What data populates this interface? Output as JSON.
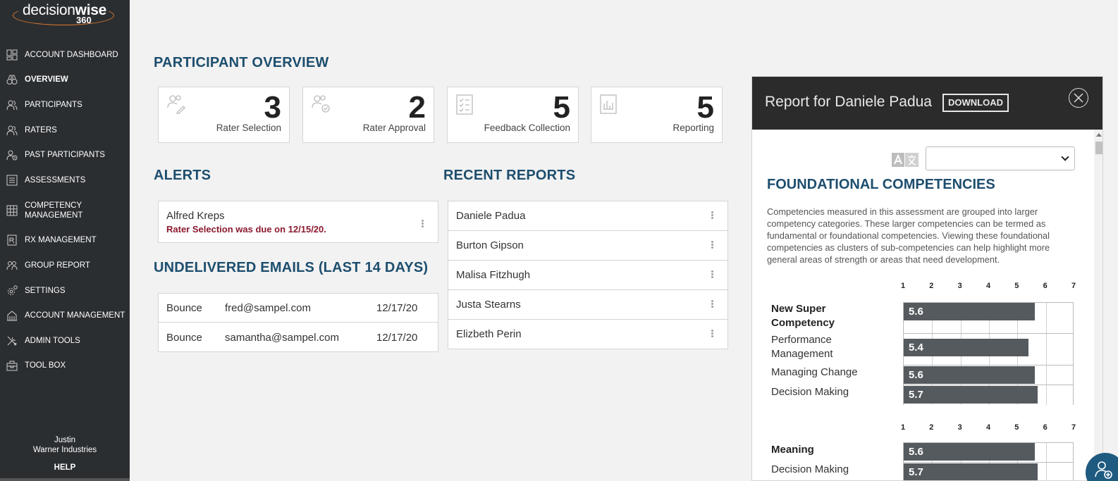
{
  "brand": {
    "word_light": "decision",
    "word_bold": "wise",
    "number": "360",
    "accent": "#e07a2f"
  },
  "sidebar": {
    "items": [
      {
        "label": "ACCOUNT DASHBOARD",
        "icon": "dashboard-icon"
      },
      {
        "label": "OVERVIEW",
        "icon": "binoculars-icon",
        "active": true
      },
      {
        "label": "PARTICIPANTS",
        "icon": "people-icon"
      },
      {
        "label": "RATERS",
        "icon": "people-icon"
      },
      {
        "label": "PAST PARTICIPANTS",
        "icon": "people-history-icon"
      },
      {
        "label": "ASSESSMENTS",
        "icon": "list-icon"
      },
      {
        "label": "COMPETENCY\nMANAGEMENT",
        "icon": "grid-icon"
      },
      {
        "label": "RX MANAGEMENT",
        "icon": "rx-icon"
      },
      {
        "label": "GROUP REPORT",
        "icon": "group-icon"
      },
      {
        "label": "SETTINGS",
        "icon": "gear-icon"
      },
      {
        "label": "ACCOUNT MANAGEMENT",
        "icon": "building-icon"
      },
      {
        "label": "ADMIN TOOLS",
        "icon": "tools-icon"
      },
      {
        "label": "TOOL BOX",
        "icon": "toolbox-icon"
      }
    ],
    "user_name": "Justin",
    "company": "Warner Industries",
    "help": "HELP"
  },
  "overview": {
    "title": "PARTICIPANT OVERVIEW",
    "stats": [
      {
        "value": "3",
        "label": "Rater Selection",
        "icon": "rater-selection-icon"
      },
      {
        "value": "2",
        "label": "Rater Approval",
        "icon": "rater-approval-icon"
      },
      {
        "value": "5",
        "label": "Feedback Collection",
        "icon": "checklist-icon"
      },
      {
        "value": "5",
        "label": "Reporting",
        "icon": "report-chart-icon"
      }
    ]
  },
  "alerts": {
    "title": "ALERTS",
    "items": [
      {
        "name": "Alfred Kreps",
        "message": "Rater Selection was due on 12/15/20."
      }
    ]
  },
  "emails": {
    "title": "UNDELIVERED EMAILS (LAST 14 DAYS)",
    "rows": [
      {
        "type": "Bounce",
        "email": "fred@sampel.com",
        "date": "12/17/20"
      },
      {
        "type": "Bounce",
        "email": "samantha@sampel.com",
        "date": "12/17/20"
      }
    ]
  },
  "recent_reports": {
    "title": "RECENT REPORTS",
    "items": [
      "Daniele Padua",
      "Burton Gipson",
      "Malisa Fitzhugh",
      "Justa Stearns",
      "Elizbeth Perin"
    ]
  },
  "report_panel": {
    "title": "Report for Daniele Padua",
    "download": "DOWNLOAD",
    "heading": "FOUNDATIONAL COMPETENCIES",
    "description": "Competencies measured in this assessment are grouped into larger competency categories. These larger competencies can be termed as fundamental or foundational competencies. Viewing these foundational competencies as clusters of sub-competencies can help highlight more general areas of strength or areas that need development.",
    "language_selected": ""
  },
  "chart_data": {
    "type": "bar",
    "orientation": "horizontal",
    "xlim": [
      1,
      7
    ],
    "ticks": [
      "1",
      "2",
      "3",
      "4",
      "5",
      "6",
      "7"
    ],
    "groups": [
      {
        "rows": [
          {
            "label": "New Super Competency",
            "value": 5.6,
            "bold": true
          },
          {
            "label": "Performance Management",
            "value": 5.4
          },
          {
            "label": "Managing Change",
            "value": 5.6
          },
          {
            "label": "Decision Making",
            "value": 5.7
          }
        ]
      },
      {
        "rows": [
          {
            "label": "Meaning",
            "value": 5.6,
            "bold": true
          },
          {
            "label": "Decision Making",
            "value": 5.7
          }
        ]
      }
    ],
    "bar_color": "#555a5f"
  },
  "colors": {
    "sidebar": "#2b2e31",
    "heading": "#1d4e6e",
    "alert": "#8b1a2f",
    "fab": "#1f5a80"
  }
}
